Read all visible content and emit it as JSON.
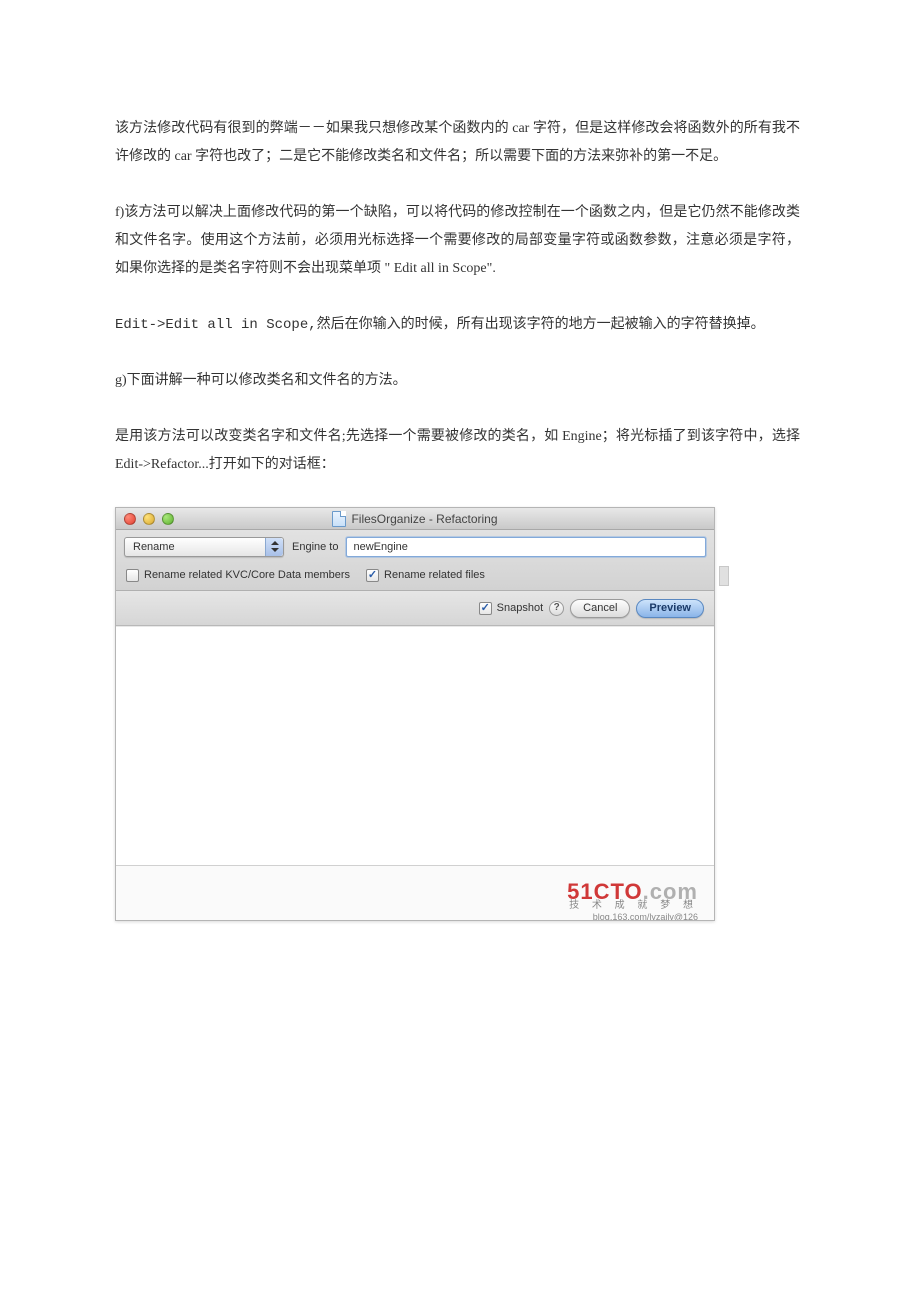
{
  "paragraphs": {
    "p1": "该方法修改代码有很到的弊端－－如果我只想修改某个函数内的 car 字符，但是这样修改会将函数外的所有我不许修改的 car 字符也改了；二是它不能修改类名和文件名；所以需要下面的方法来弥补的第一不足。",
    "p2": "f)该方法可以解决上面修改代码的第一个缺陷，可以将代码的修改控制在一个函数之内，但是它仍然不能修改类和文件名字。使用这个方法前，必须用光标选择一个需要修改的局部变量字符或函数参数，注意必须是字符，如果你选择的是类名字符则不会出现菜单项 \" Edit all in Scope\".",
    "p3": "Edit->Edit all in Scope,然后在你输入的时候，所有出现该字符的地方一起被输入的字符替换掉。",
    "p4": "g)下面讲解一种可以修改类名和文件名的方法。",
    "p5": "是用该方法可以改变类名字和文件名;先选择一个需要被修改的类名，如 Engine；将光标插了到该字符中，选择 Edit->Refactor...打开如下的对话框："
  },
  "dialog": {
    "title": "FilesOrganize - Refactoring",
    "dropdown_label": "Rename",
    "engine_label": "Engine to",
    "input_value": "newEngine",
    "chk_kvc": "Rename related KVC/Core Data members",
    "chk_files": "Rename related files",
    "snapshot_label": "Snapshot",
    "cancel": "Cancel",
    "preview": "Preview"
  },
  "watermark": {
    "brand_a": "51CTO",
    "brand_b": ".com",
    "sub": "技 术 成 就 梦 想",
    "blog": "blog.163.com/lyzaily@126"
  }
}
